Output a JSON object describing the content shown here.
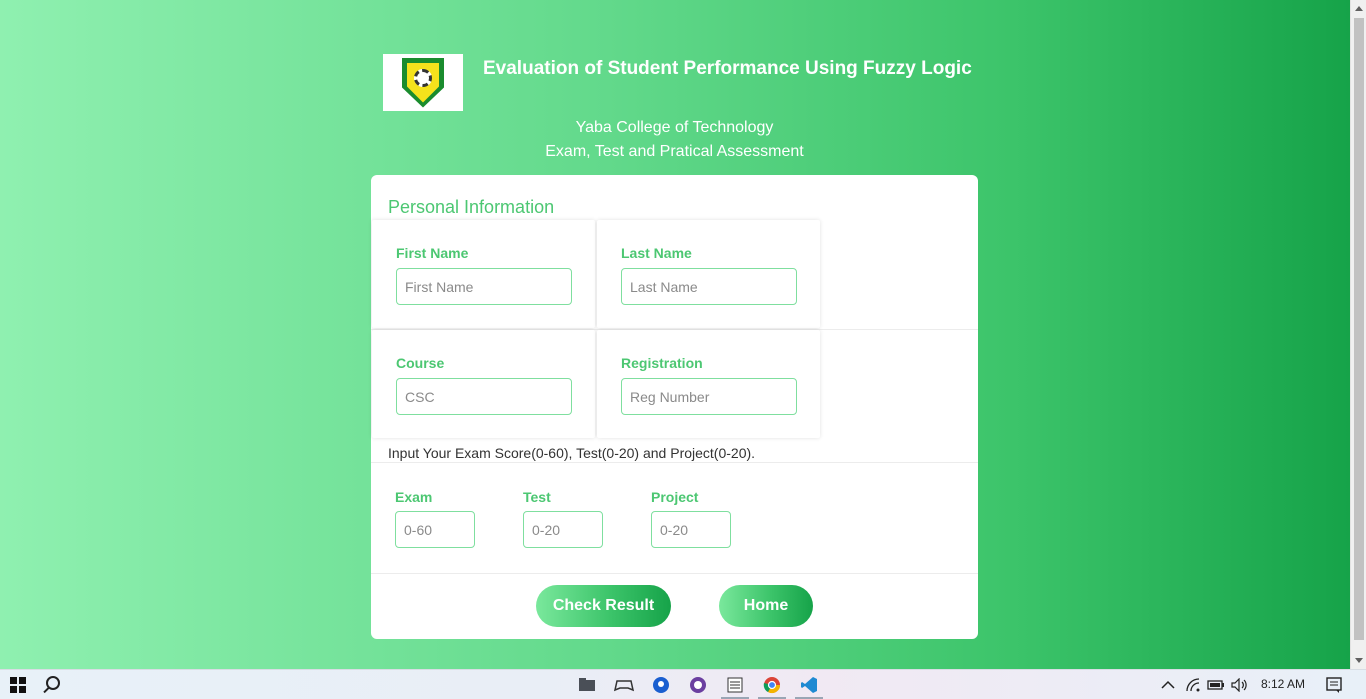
{
  "header": {
    "title": "Evaluation of Student Performance Using Fuzzy Logic",
    "institution": "Yaba College of Technology",
    "subtitle": "Exam, Test and Pratical Assessment",
    "logo_icon": "yabatech-logo"
  },
  "form": {
    "section_title": "Personal Information",
    "first_name": {
      "label": "First Name",
      "placeholder": "First Name",
      "value": ""
    },
    "last_name": {
      "label": "Last Name",
      "placeholder": "Last Name",
      "value": ""
    },
    "course": {
      "label": "Course",
      "placeholder": "CSC",
      "value": ""
    },
    "registration": {
      "label": "Registration",
      "placeholder": "Reg Number",
      "value": ""
    },
    "instructions": "Input Your Exam Score(0-60), Test(0-20) and Project(0-20).",
    "exam": {
      "label": "Exam",
      "placeholder": "0-60",
      "value": ""
    },
    "test": {
      "label": "Test",
      "placeholder": "0-20",
      "value": ""
    },
    "project": {
      "label": "Project",
      "placeholder": "0-20",
      "value": ""
    }
  },
  "buttons": {
    "check_result": "Check Result",
    "home": "Home"
  },
  "colors": {
    "accent": "#4cc772",
    "gradient_start": "#8ff0b0",
    "gradient_end": "#16a349"
  },
  "taskbar": {
    "apps": [
      "file-explorer-icon",
      "gamepad-icon",
      "maps-icon",
      "github-desktop-icon",
      "notepad-icon",
      "chrome-icon",
      "vscode-icon"
    ],
    "clock": "8:12 AM"
  }
}
